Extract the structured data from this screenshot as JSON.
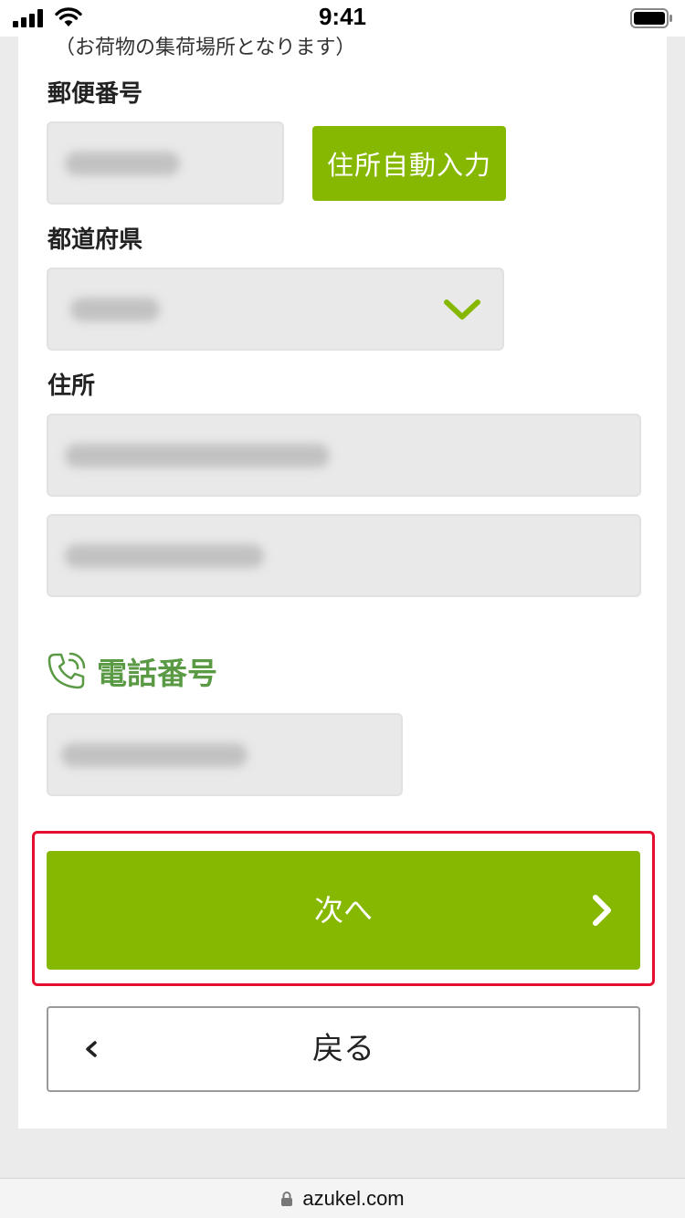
{
  "status_bar": {
    "time": "9:41"
  },
  "form": {
    "note": "（お荷物の集荷場所となります）",
    "postal": {
      "label": "郵便番号",
      "value": "",
      "autofill_button": "住所自動入力"
    },
    "prefecture": {
      "label": "都道府県",
      "selected": ""
    },
    "address": {
      "label": "住所",
      "line1": "",
      "line2": ""
    },
    "phone": {
      "heading": "電話番号",
      "value": ""
    }
  },
  "actions": {
    "next_label": "次へ",
    "back_label": "戻る"
  },
  "browser": {
    "url": "azukel.com"
  },
  "colors": {
    "accent": "#86b802",
    "heading_green": "#5b9a45",
    "highlight": "#e60e2e"
  }
}
